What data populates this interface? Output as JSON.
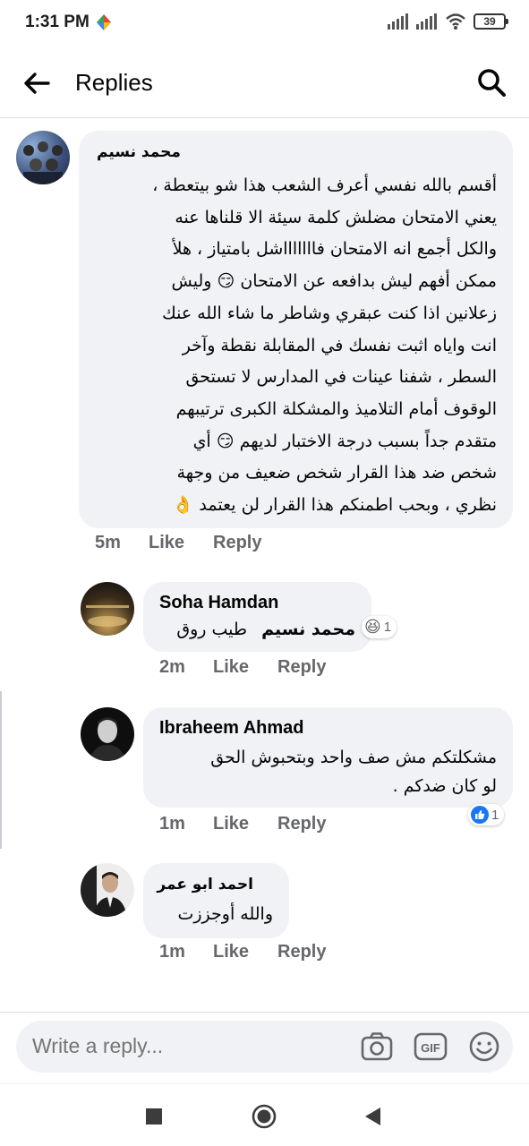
{
  "status_bar": {
    "time": "1:31 PM",
    "battery": "39"
  },
  "header": {
    "title": "Replies"
  },
  "comment": {
    "author": "محمد نسيم",
    "lines": [
      "أقسم بالله نفسي أعرف الشعب هذا شو بيتعطة ،",
      "يعني الامتحان مضلش كلمة سيئة الا قلناها عنه",
      "والكل أجمع انه الامتحان فاااااااشل بامتياز ، هلأ",
      "ممكن أفهم ليش بدافعه عن الامتحان 😏 وليش",
      "زعلانين اذا كنت عبقري وشاطر ما شاء الله عنك",
      "انت واياه اثبت نفسك في المقابلة نقطة وآخر",
      "السطر ، شفنا عينات في المدارس لا تستحق",
      "الوقوف أمام التلاميذ والمشكلة الكبرى ترتيبهم",
      "متقدم جداً بسبب درجة الاختبار لديهم 😏 أي",
      "شخص ضد هذا القرار شخص ضعيف من وجهة",
      "نظري ، وبحب اطمنكم هذا القرار لن يعتمد 👌"
    ],
    "time": "5m",
    "like": "Like",
    "reply": "Reply"
  },
  "replies": [
    {
      "author": "Soha Hamdan",
      "mention": "محمد نسيم",
      "text": "طيب روق",
      "time": "2m",
      "like": "Like",
      "reply": "Reply",
      "reaction_emoji": "😆",
      "reaction_count": "1"
    },
    {
      "author": "Ibraheem Ahmad",
      "lines": [
        "مشكلتكم مش صف واحد وبتحبوش الحق",
        "لو كان ضدكم ."
      ],
      "time": "1m",
      "like": "Like",
      "reply": "Reply",
      "reaction_icon": "like-icon",
      "reaction_count": "1"
    },
    {
      "author": "احمد ابو عمر",
      "text": "والله أوجززت",
      "time": "1m",
      "like": "Like",
      "reply": "Reply"
    }
  ],
  "composer": {
    "placeholder": "Write a reply..."
  },
  "colors": {
    "bubble": "#f0f2f5",
    "meta_text": "#65676b",
    "like_blue": "#1877f2"
  }
}
